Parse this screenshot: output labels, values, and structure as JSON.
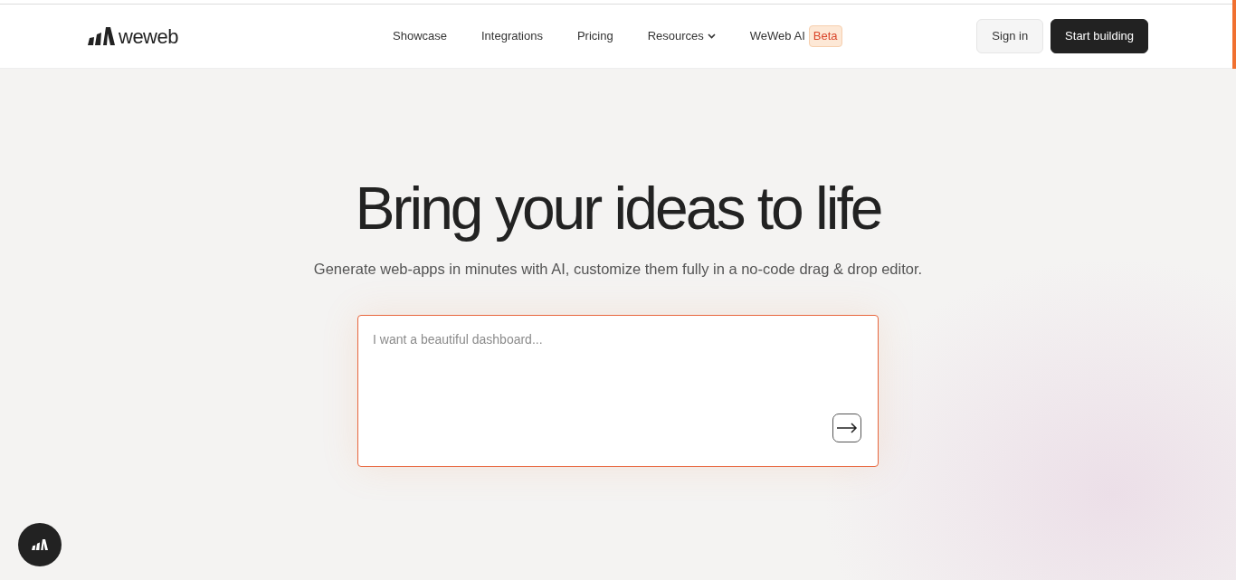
{
  "header": {
    "logo_text": "weweb",
    "nav": [
      {
        "label": "Showcase",
        "kind": "link"
      },
      {
        "label": "Integrations",
        "kind": "link"
      },
      {
        "label": "Pricing",
        "kind": "link"
      },
      {
        "label": "Resources",
        "kind": "dropdown"
      },
      {
        "label": "WeWeb AI",
        "kind": "badge",
        "badge": "Beta"
      }
    ],
    "sign_in": "Sign in",
    "cta": "Start building"
  },
  "hero": {
    "title": "Bring your ideas to life",
    "subtitle": "Generate web-apps in minutes with AI, customize them fully in a no-code drag & drop editor.",
    "prompt": {
      "placeholder": "I want a beautiful dashboard..."
    }
  }
}
